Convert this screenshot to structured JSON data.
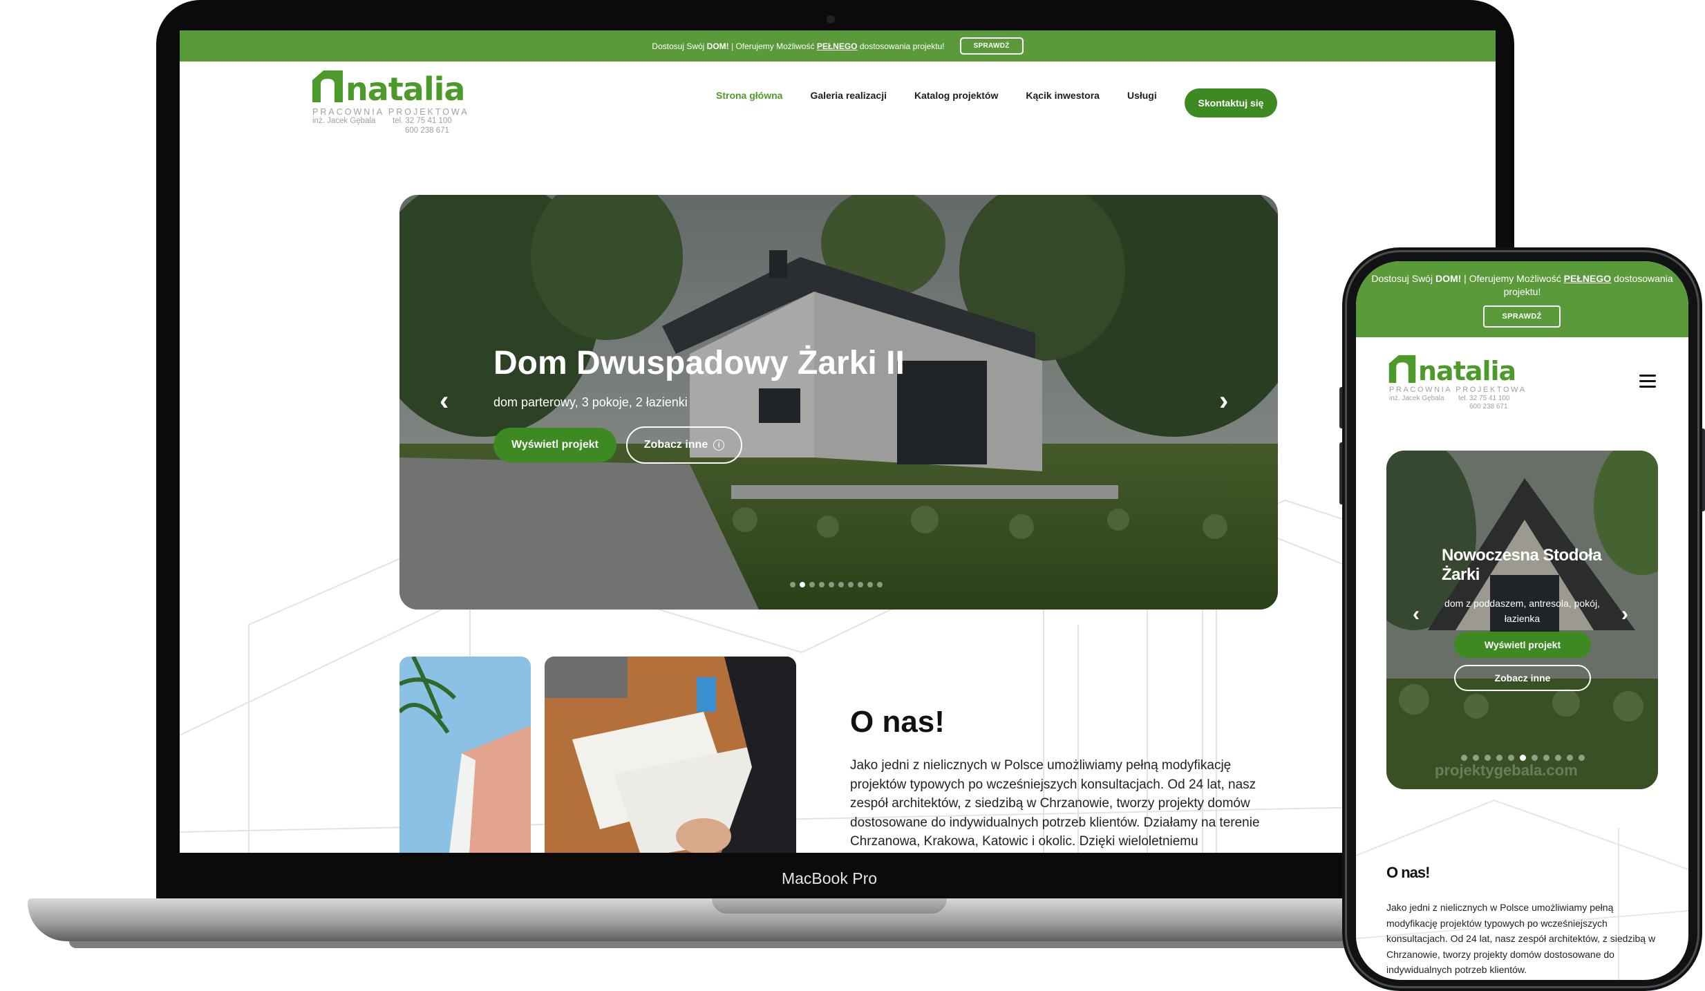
{
  "brand": {
    "accent": "#5b9a3a",
    "button_green": "#3e8a22",
    "logo_word": "natalia",
    "logo_sub": "PRACOWNIA PROJEKTOWA",
    "logo_person": "inż. Jacek Gębala",
    "logo_phone1": "tel. 32 75 41 100",
    "logo_phone2": "600 238 671"
  },
  "laptop": {
    "device_label": "MacBook Pro",
    "topbar": {
      "text_pre": "Dostosuj Swój ",
      "text_bold1": "DOM!",
      "text_mid": " | Oferujemy Możliwość ",
      "text_bold2": "PEŁNEGO",
      "text_post": " dostosowania projektu!",
      "button": "SPRAWDŹ"
    },
    "nav": [
      {
        "label": "Strona główna"
      },
      {
        "label": "Galeria realizacji"
      },
      {
        "label": "Katalog projektów"
      },
      {
        "label": "Kącik inwestora"
      },
      {
        "label": "Usługi"
      }
    ],
    "cta": "Skontaktuj się",
    "hero": {
      "title": "Dom Dwuspadowy Żarki II",
      "subtitle": "dom parterowy, 3 pokoje, 2 łazienki",
      "primary_button": "Wyświetl projekt",
      "secondary_button": "Zobacz inne",
      "slide_count": 10,
      "active_slide": 1,
      "prev_arrow": "‹",
      "next_arrow": "›"
    },
    "about": {
      "title": "O nas!",
      "text": "Jako jedni z nielicznych w Polsce umożliwiamy pełną modyfikację projektów typowych po wcześniejszych konsultacjach. Od 24 lat, nasz zespół architektów, z siedzibą w Chrzanowie, tworzy projekty domów dostosowane do indywidualnych potrzeb klientów. Działamy na terenie Chrzanowa, Krakowa, Katowic i okolic. Dzięki wieloletniemu"
    }
  },
  "phone": {
    "topbar": {
      "text_pre": "Dostosuj Swój ",
      "text_bold1": "DOM!",
      "text_mid": " | Oferujemy Możliwość ",
      "text_bold2": "PEŁNEGO",
      "text_post": " dostosowania projektu!",
      "button": "SPRAWDŹ"
    },
    "menu_icon": "hamburger-icon",
    "hero": {
      "title": "Nowoczesna Stodoła Żarki",
      "subtitle": "dom z poddaszem, antresola, pokój, łazienka",
      "primary_button": "Wyświetl projekt",
      "secondary_button": "Zobacz inne",
      "watermark": "projektygebala.com",
      "slide_count": 11,
      "active_slide": 5,
      "prev_arrow": "‹",
      "next_arrow": "›"
    },
    "about": {
      "title": "O nas!",
      "text": "Jako jedni z nielicznych w Polsce umożliwiamy pełną modyfikację projektów typowych po wcześniejszych konsultacjach. Od 24 lat, nasz zespół architektów, z siedzibą w Chrzanowie, tworzy projekty domów dostosowane do indywidualnych potrzeb klientów."
    }
  }
}
